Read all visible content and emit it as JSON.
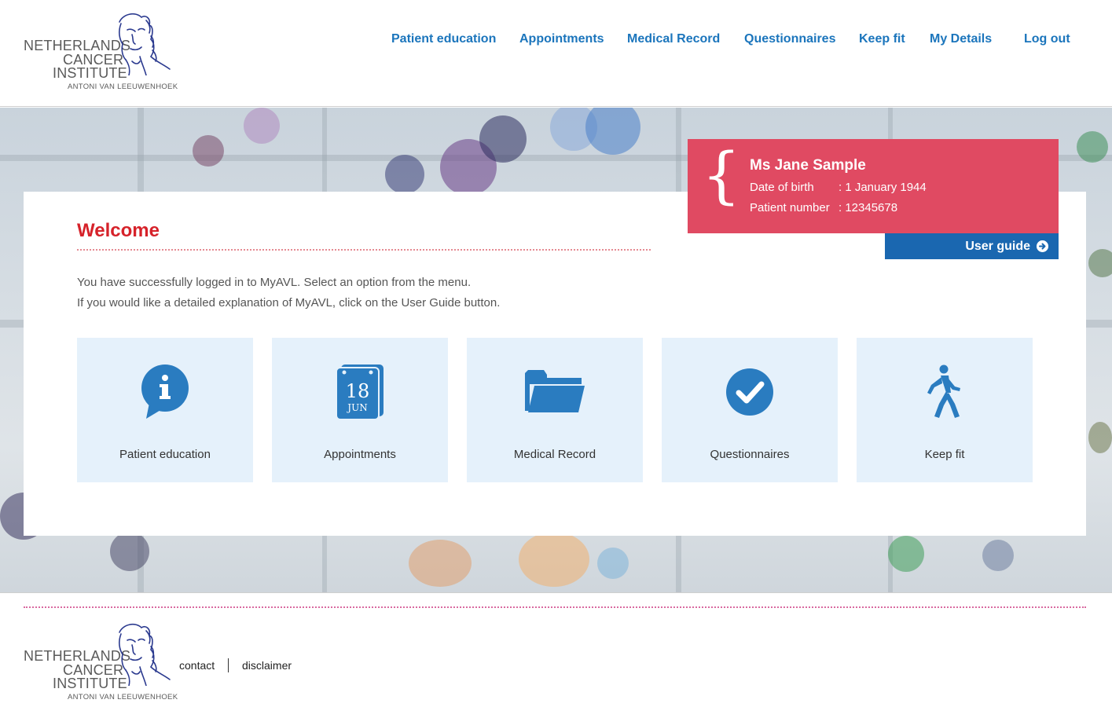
{
  "logo": {
    "line1": "NETHERLANDS",
    "line2": "CANCER",
    "line3": "INSTITUTE",
    "line4": "ANTONI VAN LEEUWENHOEK"
  },
  "nav": {
    "items": [
      {
        "label": "Patient education"
      },
      {
        "label": "Appointments"
      },
      {
        "label": "Medical Record"
      },
      {
        "label": "Questionnaires"
      },
      {
        "label": "Keep fit"
      },
      {
        "label": "My Details"
      }
    ],
    "logout": "Log out"
  },
  "welcome": {
    "title": "Welcome",
    "line1": "You have successfully logged in to MyAVL. Select an option from the menu.",
    "line2": "If you would like a detailed explanation of MyAVL, click on the User Guide button."
  },
  "tiles": [
    {
      "label": "Patient education",
      "icon": "info-icon"
    },
    {
      "label": "Appointments",
      "icon": "calendar-icon",
      "day": "18",
      "month": "JUN"
    },
    {
      "label": "Medical Record",
      "icon": "folder-icon"
    },
    {
      "label": "Questionnaires",
      "icon": "checkmark-icon"
    },
    {
      "label": "Keep fit",
      "icon": "walking-person-icon"
    }
  ],
  "patient": {
    "brace": "{",
    "name": "Ms  Jane Sample",
    "dob_label": "Date of birth",
    "dob_value": ": 1 January 1944",
    "number_label": "Patient number",
    "number_value": ": 12345678"
  },
  "user_guide": {
    "label": "User guide"
  },
  "footer": {
    "contact": "contact",
    "disclaimer": "disclaimer"
  },
  "colors": {
    "brand_blue": "#1b75bc",
    "guide_blue": "#1a67b0",
    "welcome_red": "#d6222a",
    "patient_pink": "#e04a62",
    "tile_bg": "#e5f1fb",
    "icon_blue": "#2a7cc0"
  }
}
